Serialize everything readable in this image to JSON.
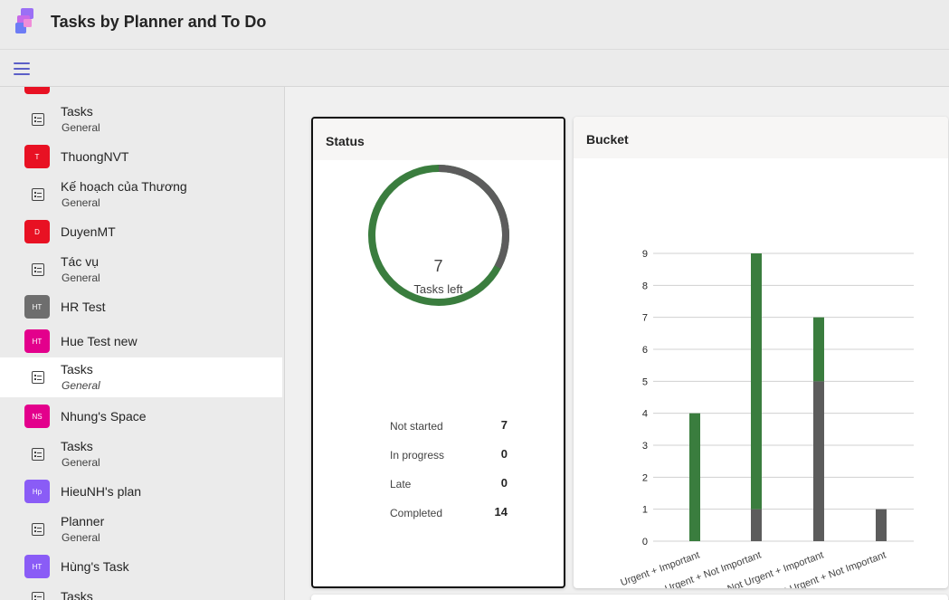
{
  "app": {
    "title": "Tasks by Planner and To Do"
  },
  "sidebar": {
    "items": [
      {
        "kind": "avatar",
        "initials": "",
        "name": "",
        "color": "#e81123"
      },
      {
        "kind": "plan",
        "name": "Tasks",
        "sub": "General"
      },
      {
        "kind": "avatar",
        "initials": "T",
        "name": "ThuongNVT",
        "color": "#e81123"
      },
      {
        "kind": "plan",
        "name": "Kế hoạch của Thương",
        "sub": "General"
      },
      {
        "kind": "avatar",
        "initials": "D",
        "name": "DuyenMT",
        "color": "#e81123"
      },
      {
        "kind": "plan",
        "name": "Tác vụ",
        "sub": "General"
      },
      {
        "kind": "avatar",
        "initials": "HT",
        "name": "HR Test",
        "color": "#6e6e6e"
      },
      {
        "kind": "avatar",
        "initials": "HT",
        "name": "Hue Test new",
        "color": "#e3008c"
      },
      {
        "kind": "plan",
        "name": "Tasks",
        "sub": "General",
        "selected": true
      },
      {
        "kind": "avatar",
        "initials": "NS",
        "name": "Nhung's Space",
        "color": "#e3008c"
      },
      {
        "kind": "plan",
        "name": "Tasks",
        "sub": "General"
      },
      {
        "kind": "avatar",
        "initials": "Hp",
        "name": "HieuNH's plan",
        "color": "#8a5cf6"
      },
      {
        "kind": "plan",
        "name": "Planner",
        "sub": "General"
      },
      {
        "kind": "avatar",
        "initials": "HT",
        "name": "Hùng's Task",
        "color": "#8a5cf6"
      },
      {
        "kind": "plan",
        "name": "Tasks",
        "sub": ""
      }
    ]
  },
  "status": {
    "title": "Status",
    "donut": {
      "number": "7",
      "label": "Tasks left",
      "remaining_fraction": 0.333,
      "colors": {
        "remaining": "#5c5c5c",
        "completed": "#3a7d3e"
      }
    },
    "rows": [
      {
        "label": "Not started",
        "value": "7"
      },
      {
        "label": "In progress",
        "value": "0"
      },
      {
        "label": "Late",
        "value": "0"
      },
      {
        "label": "Completed",
        "value": "14"
      }
    ]
  },
  "bucket": {
    "title": "Bucket",
    "chart_data": {
      "type": "bar",
      "stacked": true,
      "categories": [
        "Urgent + Important",
        "Urgent + Not Important",
        "Not Urgent + Important",
        "Not Urgent + Not Important"
      ],
      "series": [
        {
          "values": [
            0,
            1,
            5,
            1
          ],
          "color": "#5c5c5c"
        },
        {
          "values": [
            4,
            8,
            2,
            0
          ],
          "color": "#3a7d3e"
        }
      ],
      "ylim": [
        0,
        9
      ],
      "yticks": [
        "0",
        "1",
        "2",
        "3",
        "4",
        "5",
        "6",
        "7",
        "8",
        "9"
      ],
      "grid": true
    }
  },
  "colors": {
    "accent": "#5b5fc7"
  }
}
